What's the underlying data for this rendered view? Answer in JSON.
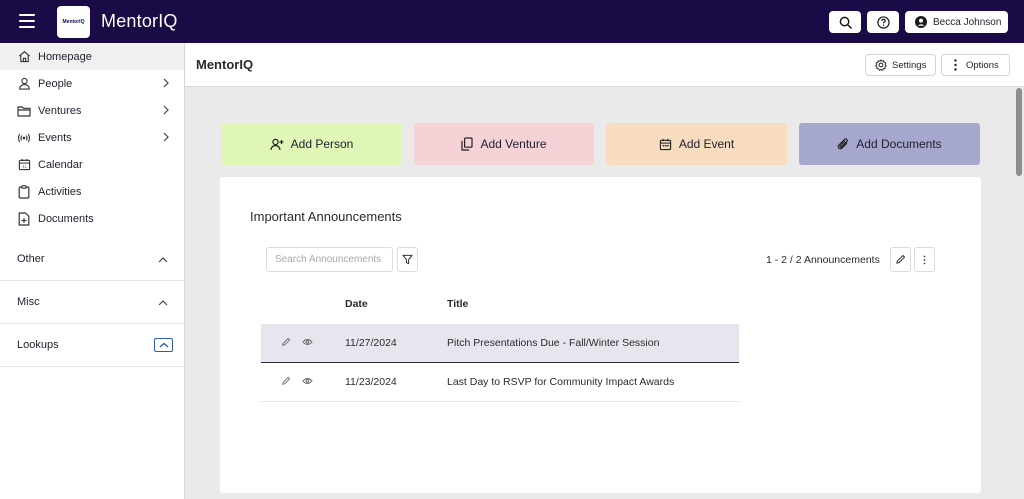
{
  "app": {
    "name": "MentorIQ",
    "logo_text": "MentorIQ"
  },
  "topbar": {
    "user_name": "Becca Johnson"
  },
  "sidebar": {
    "items": [
      {
        "label": "Homepage",
        "icon": "home-icon",
        "active": true,
        "expandable": false
      },
      {
        "label": "People",
        "icon": "person-icon",
        "expandable": true
      },
      {
        "label": "Ventures",
        "icon": "folder-icon",
        "expandable": true
      },
      {
        "label": "Events",
        "icon": "broadcast-icon",
        "expandable": true
      },
      {
        "label": "Calendar",
        "icon": "calendar-icon",
        "expandable": false
      },
      {
        "label": "Activities",
        "icon": "clipboard-icon",
        "expandable": false
      },
      {
        "label": "Documents",
        "icon": "document-add-icon",
        "expandable": false
      }
    ],
    "sections": [
      {
        "label": "Other"
      },
      {
        "label": "Misc"
      },
      {
        "label": "Lookups"
      }
    ]
  },
  "header": {
    "title": "MentorIQ",
    "settings_label": "Settings",
    "options_label": "Options"
  },
  "quick_actions": [
    {
      "label": "Add Person",
      "icon": "add-person-icon",
      "color": "#dff6b6"
    },
    {
      "label": "Add Venture",
      "icon": "copy-icon",
      "color": "#f4d2d6"
    },
    {
      "label": "Add Event",
      "icon": "calendar-icon",
      "color": "#f8dcc0"
    },
    {
      "label": "Add Documents",
      "icon": "paperclip-icon",
      "color": "#a6a7cc"
    }
  ],
  "announcements": {
    "title": "Important Announcements",
    "search_placeholder": "Search Announcements",
    "count_text": "1 - 2 / 2 Announcements",
    "columns": {
      "date": "Date",
      "title": "Title"
    },
    "rows": [
      {
        "date": "11/27/2024",
        "title": "Pitch Presentations Due - Fall/Winter Session",
        "selected": true
      },
      {
        "date": "11/23/2024",
        "title": "Last Day to RSVP for Community Impact Awards",
        "selected": false
      }
    ]
  },
  "colors": {
    "topbar": "#1a0a45",
    "accent": "#2b5bbd",
    "selected_row": "#e7e6ef"
  }
}
